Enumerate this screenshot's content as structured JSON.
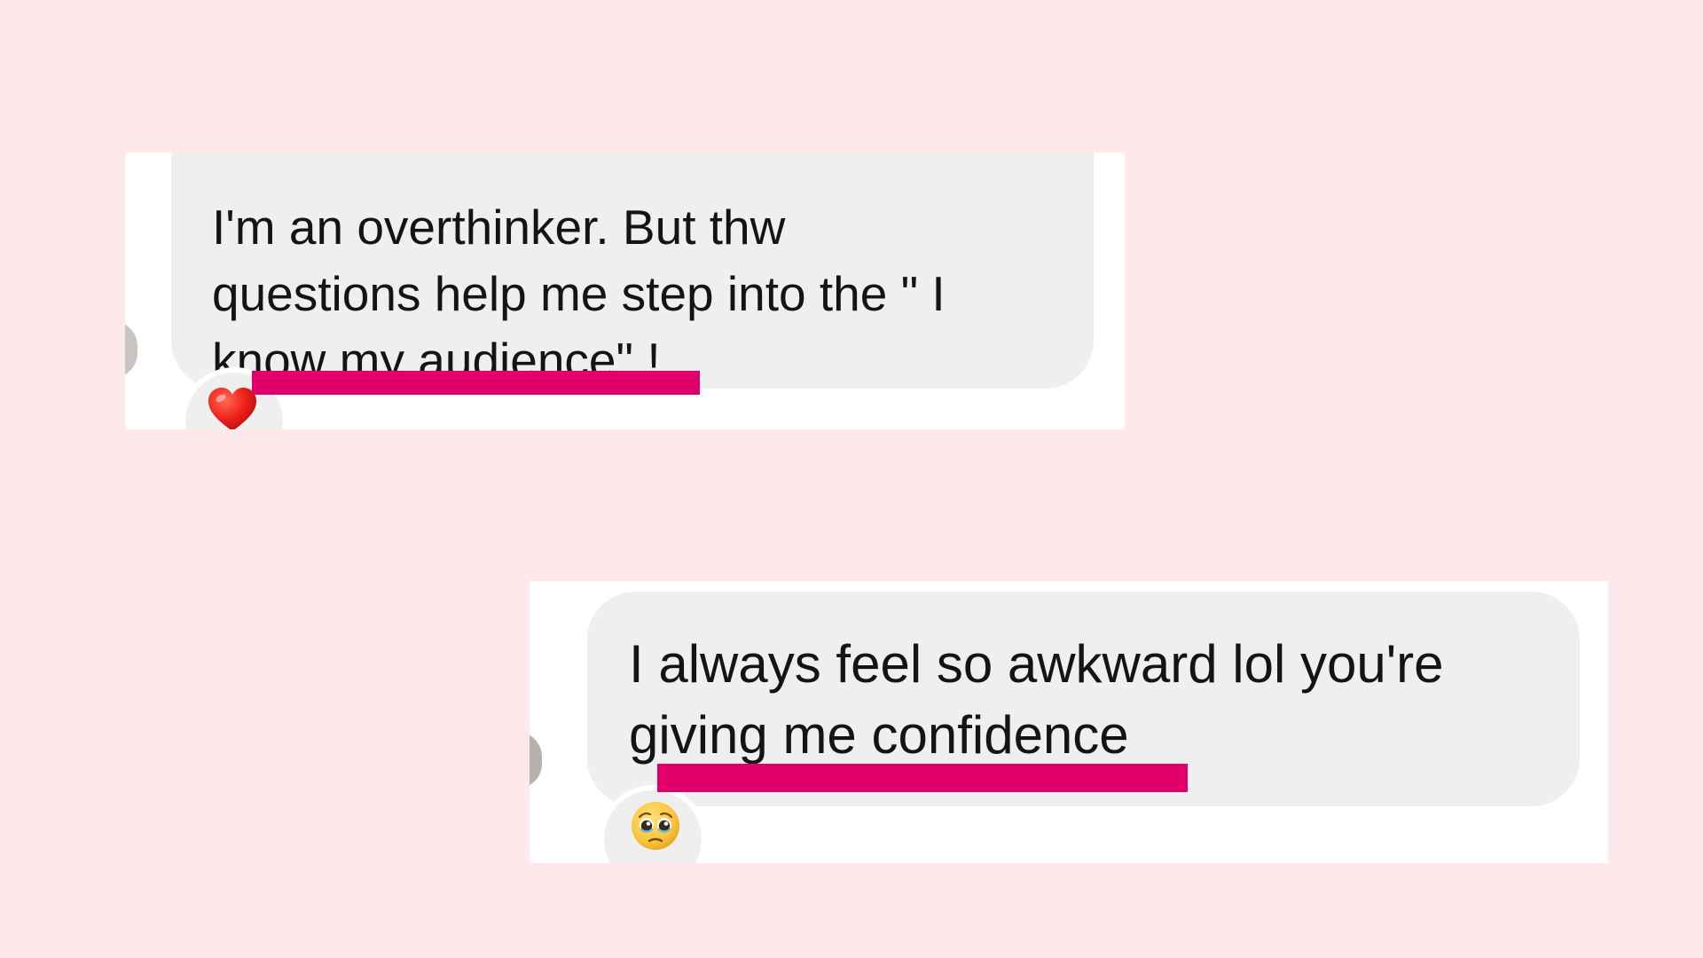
{
  "message_1": {
    "lines": [
      "I'm an overthinker. But thw",
      "questions help me step into the \" I",
      "know my audience\" !"
    ],
    "reaction_icon": "red-heart-emoji"
  },
  "message_2": {
    "lines": [
      "I always feel so awkward lol you're",
      "giving me confidence"
    ],
    "reaction_icon": "pleading-face-emoji"
  },
  "colors": {
    "background": "#fde8ec",
    "card": "#ffffff",
    "bubble": "#efeff0",
    "highlight": "#e1006a",
    "text": "#141414"
  }
}
